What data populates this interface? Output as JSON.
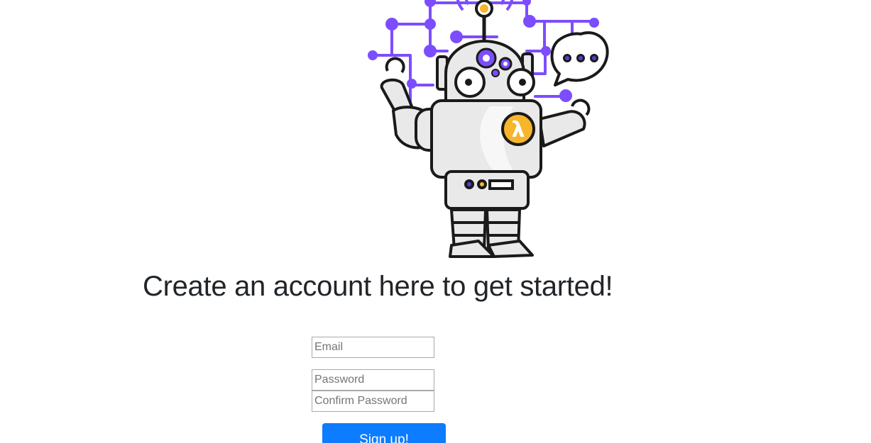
{
  "illustration": {
    "name": "lambda-robot-illustration",
    "badge_glyph": "λ",
    "colors": {
      "circuit": "#7c4dff",
      "outline": "#1a1a1a",
      "body": "#e9e9e9",
      "badge": "#f7b52c"
    }
  },
  "header": {
    "title": "Create an account here to get started!"
  },
  "form": {
    "email_placeholder": "Email",
    "password_placeholder": "Password",
    "confirm_password_placeholder": "Confirm Password",
    "submit_label": "Sign up!"
  },
  "theme": {
    "primary": "#0d7cff"
  }
}
